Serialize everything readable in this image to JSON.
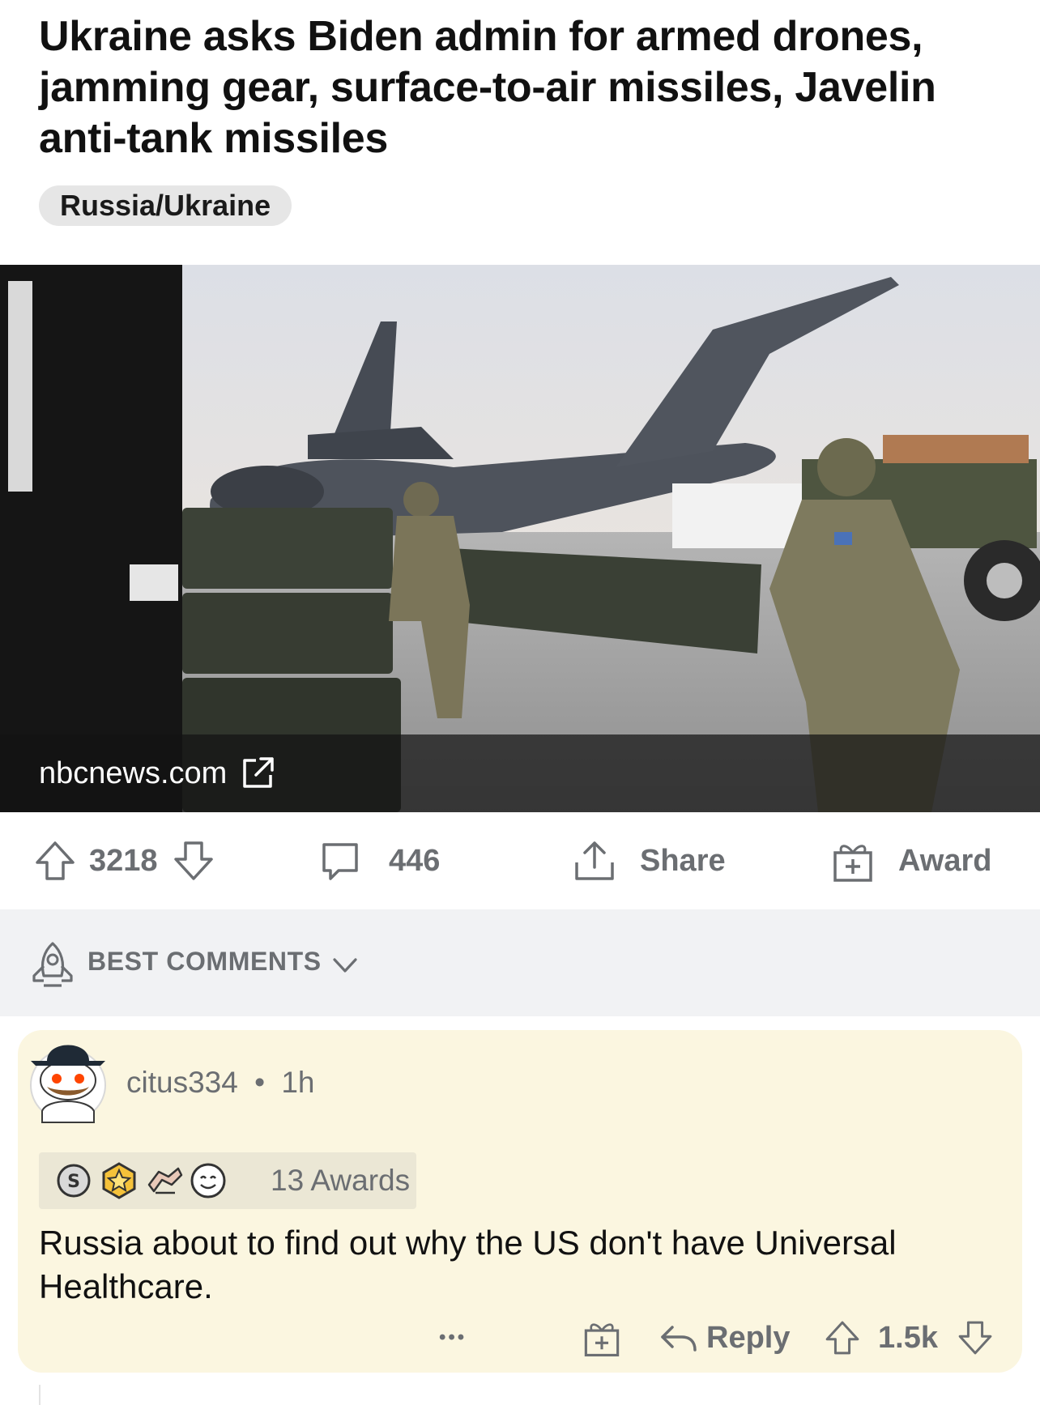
{
  "post": {
    "title": "Ukraine asks Biden admin for armed drones, jamming gear, surface-to-air missiles, Javelin anti-tank missiles",
    "flair": "Russia/Ukraine",
    "link_domain": "nbcnews.com",
    "score": "3218",
    "comments_count": "446",
    "share_label": "Share",
    "award_label": "Award"
  },
  "comments_header": {
    "sort_label": "BEST COMMENTS"
  },
  "comment": {
    "username": "citus334",
    "separator": "•",
    "age": "1h",
    "awards_label": "13 Awards",
    "body": "Russia about to find out why the US don't have Universal Healthcare.",
    "more_label": "•••",
    "reply_label": "Reply",
    "score": "1.5k"
  },
  "icons": [
    "upvote-icon",
    "downvote-icon",
    "comment-icon",
    "share-icon",
    "award-icon",
    "rocket-icon",
    "chevron-down-icon",
    "external-link-icon",
    "avatar",
    "silver-award-icon",
    "gold-award-icon",
    "wholesome-award-icon",
    "helpful-award-icon",
    "more-icon",
    "gift-icon",
    "reply-icon"
  ],
  "colors": {
    "meta_gray": "#6b6e72",
    "comment_highlight": "#fbf6e0",
    "sort_bar": "#f1f2f4"
  }
}
